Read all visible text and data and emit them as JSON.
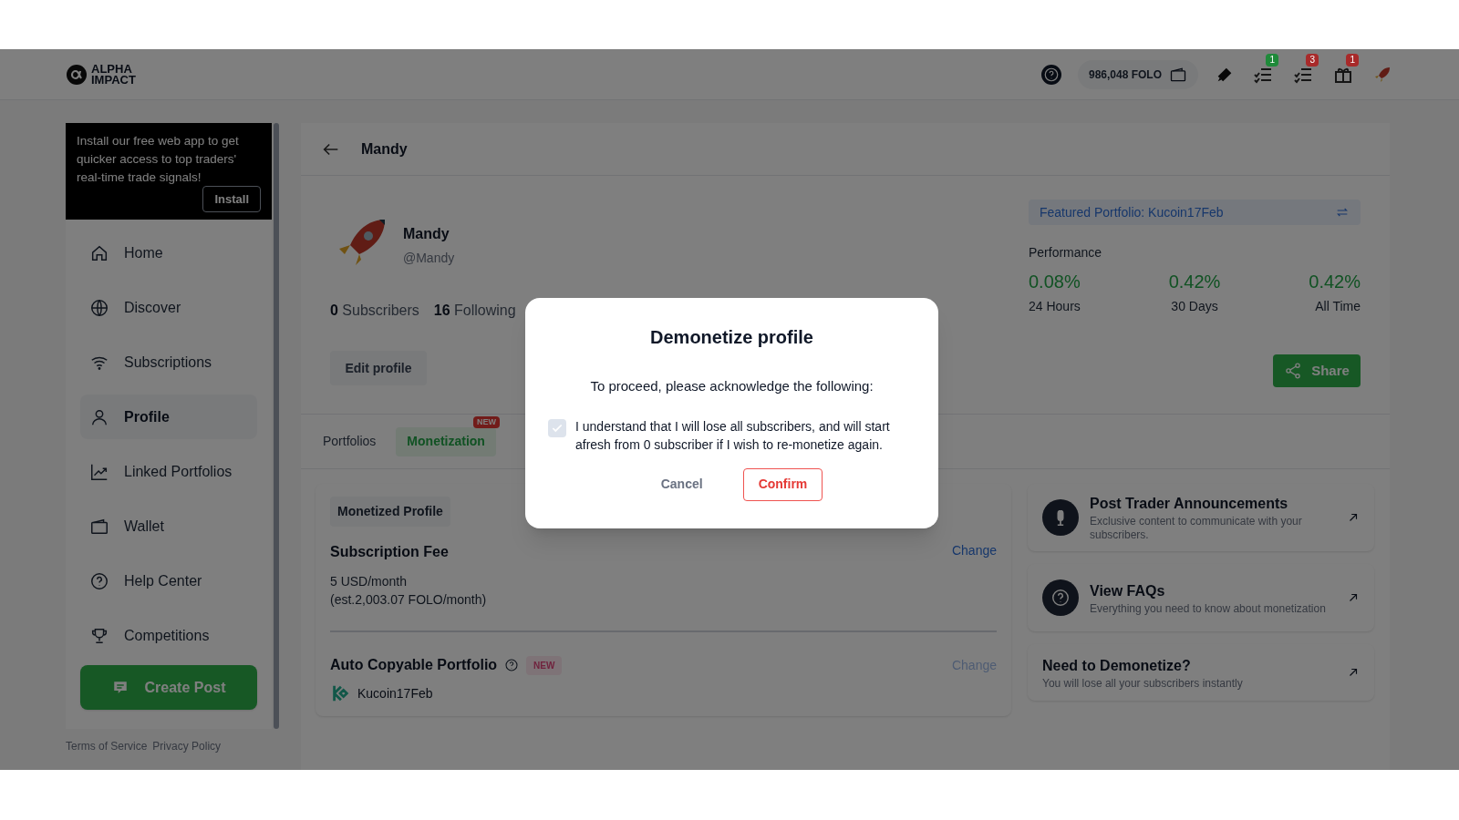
{
  "header": {
    "logo": "ALPHA IMPACT",
    "balance": "986,048 FOLO",
    "badges": [
      {
        "kind": "tasks",
        "count": "1",
        "color": "#1f8a3a"
      },
      {
        "kind": "tasks",
        "count": "3",
        "color": "#a82a2a"
      },
      {
        "kind": "gift",
        "count": "1",
        "color": "#a82a2a"
      }
    ]
  },
  "install_banner": {
    "text": "Install our free web app to get quicker access to top traders' real-time trade signals!",
    "button": "Install"
  },
  "sidebar": {
    "items": [
      {
        "label": "Home",
        "selected": false
      },
      {
        "label": "Discover",
        "selected": false
      },
      {
        "label": "Subscriptions",
        "selected": false
      },
      {
        "label": "Profile",
        "selected": true
      },
      {
        "label": "Linked Portfolios",
        "selected": false
      },
      {
        "label": "Wallet",
        "selected": false
      },
      {
        "label": "Help Center",
        "selected": false
      },
      {
        "label": "Competitions",
        "selected": false
      }
    ],
    "create_button": "Create Post",
    "footer_links": [
      "Terms of Service",
      "Privacy Policy"
    ]
  },
  "page": {
    "title": "Mandy",
    "profile": {
      "name": "Mandy",
      "handle": "@Mandy",
      "subscribers": "0",
      "subscribers_label": "Subscribers",
      "following": "16",
      "following_label": "Following",
      "edit_button": "Edit profile"
    },
    "featured": "Featured Portfolio: Kucoin17Feb",
    "performance": {
      "title": "Performance",
      "stats": [
        {
          "value": "0.08%",
          "label": "24 Hours"
        },
        {
          "value": "0.42%",
          "label": "30 Days"
        },
        {
          "value": "0.42%",
          "label": "All Time"
        }
      ]
    },
    "share_button": "Share",
    "tabs": [
      {
        "label": "Portfolios",
        "selected": false
      },
      {
        "label": "Monetization",
        "selected": true,
        "badge": "NEW"
      }
    ],
    "monetization": {
      "tag": "Monetized Profile",
      "fee_title": "Subscription Fee",
      "fee_change": "Change",
      "fee_lines": [
        "5 USD/month",
        "(est.2,003.07 FOLO/month)"
      ],
      "portfolio_title": "Auto Copyable Portfolio",
      "portfolio_badge": "NEW",
      "portfolio_change": "Change",
      "portfolio_name": "Kucoin17Feb"
    },
    "cards": [
      {
        "kind": "icon",
        "title": "Post Trader Announcements",
        "text": "Exclusive content to communicate with your subscribers."
      },
      {
        "kind": "icon",
        "title": "View FAQs",
        "text": "Everything you need to know about monetization"
      },
      {
        "kind": "plain",
        "title": "Need to Demonetize?",
        "text": "You will lose all your subscribers instantly"
      }
    ]
  },
  "modal": {
    "title": "Demonetize profile",
    "intro": "To proceed, please acknowledge the following:",
    "checkbox": {
      "label": "I understand that I will lose all subscribers, and will start afresh from 0 subscriber if I wish to re-monetize again.",
      "checked": true
    },
    "cancel": "Cancel",
    "confirm": "Confirm"
  }
}
